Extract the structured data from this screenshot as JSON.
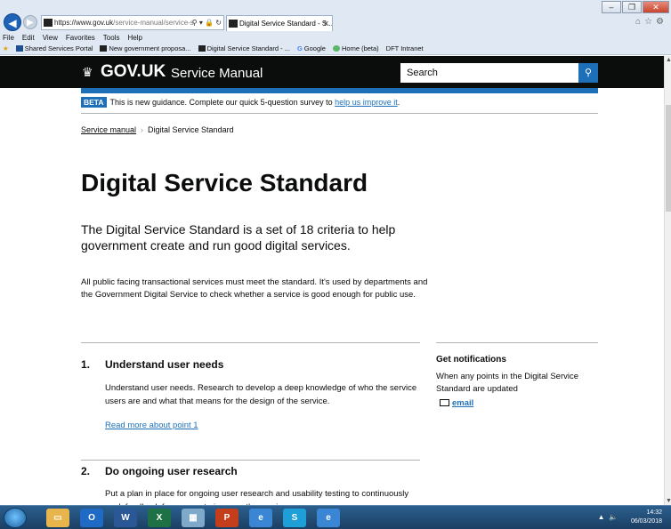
{
  "browser": {
    "address_prefix": "https://www.gov.uk",
    "address_suffix": "/service-manual/service-s",
    "tab_title": "Digital Service Standard - S...",
    "menu": [
      "File",
      "Edit",
      "View",
      "Favorites",
      "Tools",
      "Help"
    ],
    "favorites": [
      "Shared Services Portal",
      "New government proposa...",
      "Digital Service Standard - ...",
      "Google",
      "Home (beta)",
      "DFT Intranet"
    ]
  },
  "header": {
    "logo": "GOV.UK",
    "site_name": "Service Manual",
    "search_placeholder": "Search"
  },
  "beta": {
    "tag": "BETA",
    "text": "This is new guidance. Complete our quick 5-question survey to",
    "link": "help us improve it",
    "end": "."
  },
  "breadcrumb": {
    "link": "Service manual",
    "current": "Digital Service Standard"
  },
  "main": {
    "title": "Digital Service Standard",
    "lead": "The Digital Service Standard is a set of 18 criteria to help government create and run good digital services.",
    "body": "All public facing transactional services must meet the standard. It's used by departments and the Government Digital Service to check whether a service is good enough for public use.",
    "points": [
      {
        "num": "1.",
        "title": "Understand user needs",
        "desc": "Understand user needs. Research to develop a deep knowledge of who the service users are and what that means for the design of the service.",
        "link": "Read more about point 1"
      },
      {
        "num": "2.",
        "title": "Do ongoing user research",
        "desc": "Put a plan in place for ongoing user research and usability testing to continuously seek feedback from users to improve the service."
      }
    ]
  },
  "sidebar": {
    "title": "Get notifications",
    "text": "When any points in the Digital Service Standard are updated",
    "email": "email"
  },
  "taskbar": {
    "time": "14:32",
    "date": "06/03/2018"
  },
  "colors": {
    "govuk_black": "#0b0c0c",
    "govuk_blue": "#1d70b8",
    "border": "#b1b4b6"
  }
}
